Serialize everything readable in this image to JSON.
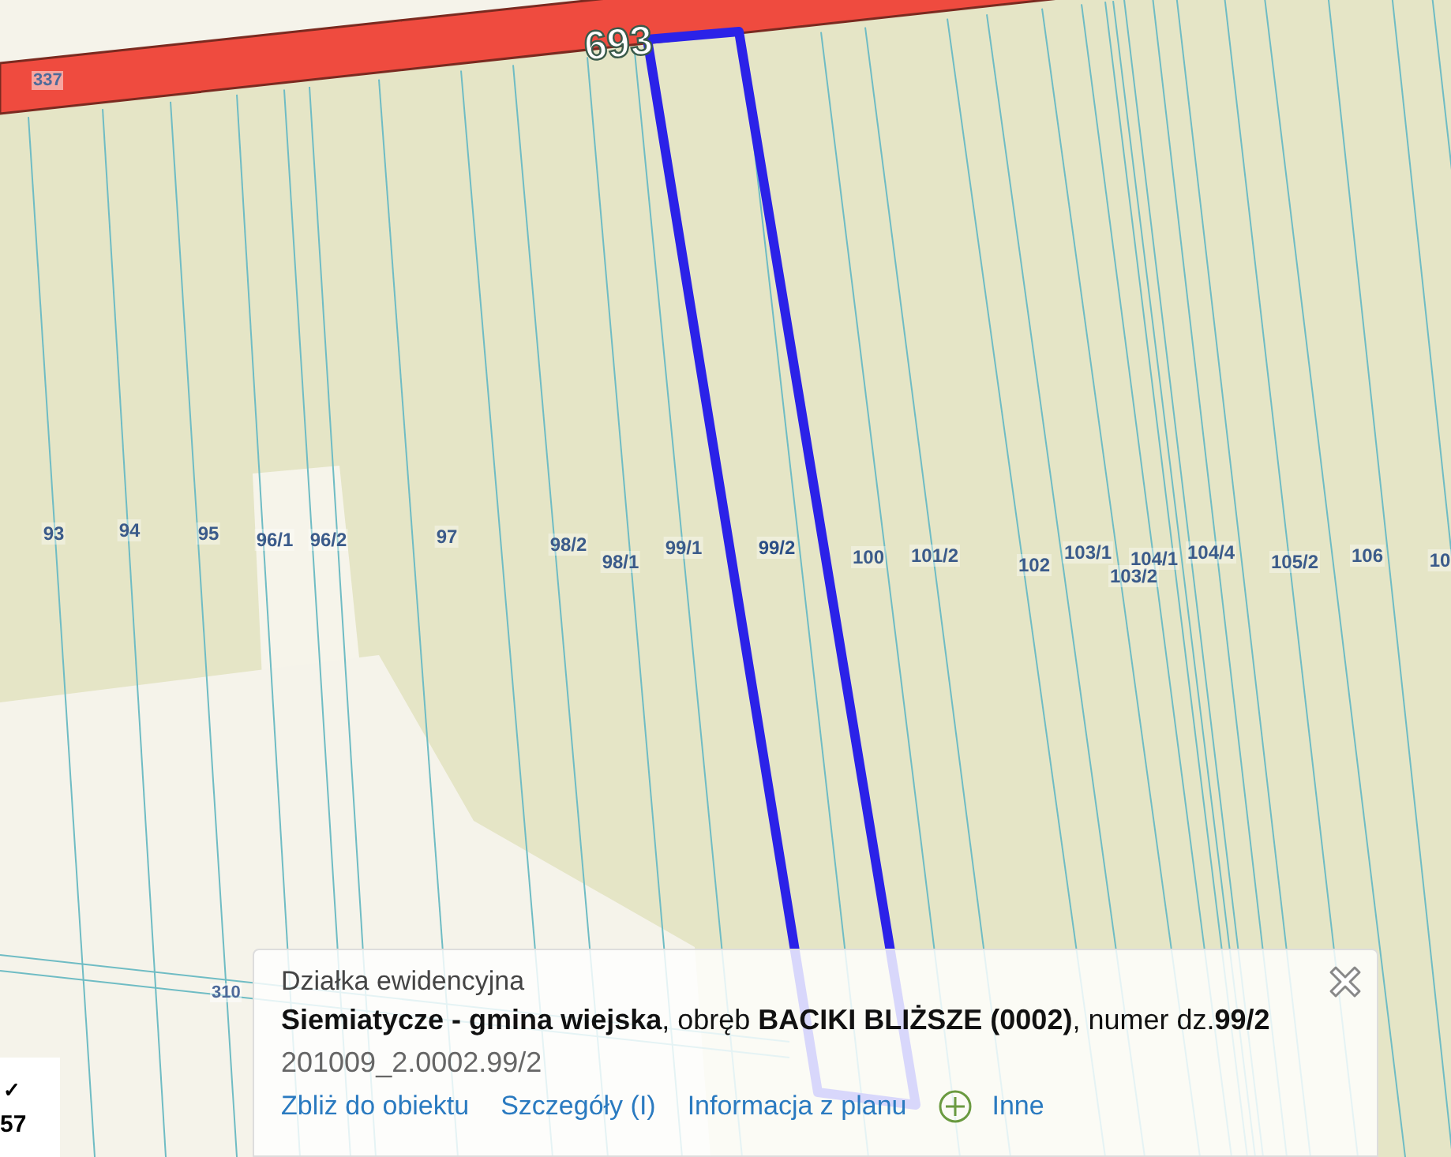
{
  "map": {
    "road_labels": [
      {
        "text": "693",
        "kind": "road"
      },
      {
        "text": "337",
        "kind": "plot"
      },
      {
        "text": "310",
        "kind": "plot"
      }
    ],
    "parcels": [
      {
        "label": "93",
        "selected": false
      },
      {
        "label": "94",
        "selected": false
      },
      {
        "label": "95",
        "selected": false
      },
      {
        "label": "96/1",
        "selected": false
      },
      {
        "label": "96/2",
        "selected": false
      },
      {
        "label": "97",
        "selected": false
      },
      {
        "label": "98/2",
        "selected": false
      },
      {
        "label": "98/1",
        "selected": false
      },
      {
        "label": "99/1",
        "selected": false
      },
      {
        "label": "99/2",
        "selected": true
      },
      {
        "label": "100",
        "selected": false
      },
      {
        "label": "101/2",
        "selected": false
      },
      {
        "label": "102",
        "selected": false
      },
      {
        "label": "103/1",
        "selected": false
      },
      {
        "label": "103/2",
        "selected": false
      },
      {
        "label": "104/1",
        "selected": false
      },
      {
        "label": "104/4",
        "selected": false
      },
      {
        "label": "105/2",
        "selected": false
      },
      {
        "label": "106",
        "selected": false
      },
      {
        "label": "10",
        "selected": false
      }
    ]
  },
  "corner_panel": {
    "mark": "✓",
    "text": "57"
  },
  "popup": {
    "title": "Działka ewidencyjna",
    "description": "**Siemiatycze - gmina wiejska**, obręb **BACIKI BLIŻSZE (0002)**, numer dz.**99/2**",
    "identifier": "201009_2.0002.99/2",
    "links": [
      {
        "label": "Zbliż do obiektu",
        "kind": "link"
      },
      {
        "label": "Szczegóły (I)",
        "kind": "link"
      },
      {
        "label": "Informacja z planu",
        "kind": "link"
      },
      {
        "label": "Inne",
        "kind": "more"
      }
    ]
  }
}
